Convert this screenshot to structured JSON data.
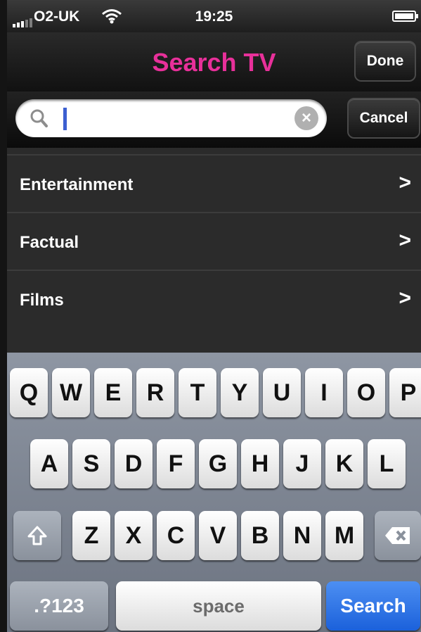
{
  "status_bar": {
    "carrier": "O2-UK",
    "time": "19:25"
  },
  "nav": {
    "title": "Search TV",
    "done_label": "Done"
  },
  "search": {
    "value": "",
    "placeholder": "",
    "cancel_label": "Cancel"
  },
  "categories": [
    {
      "label": "Entertainment"
    },
    {
      "label": "Factual"
    },
    {
      "label": "Films"
    }
  ],
  "keyboard": {
    "row1": [
      "Q",
      "W",
      "E",
      "R",
      "T",
      "Y",
      "U",
      "I",
      "O",
      "P"
    ],
    "row2": [
      "A",
      "S",
      "D",
      "F",
      "G",
      "H",
      "J",
      "K",
      "L"
    ],
    "row3": [
      "Z",
      "X",
      "C",
      "V",
      "B",
      "N",
      "M"
    ],
    "numbers_label": ".?123",
    "space_label": "space",
    "search_label": "Search"
  },
  "colors": {
    "title_accent": "#e8309a",
    "search_key": "#2e74e6",
    "caret": "#3c5fd1"
  },
  "icons": [
    "signal-icon",
    "wifi-icon",
    "battery-icon",
    "search-icon",
    "clear-icon",
    "chevron-right-icon",
    "shift-icon",
    "backspace-icon"
  ]
}
